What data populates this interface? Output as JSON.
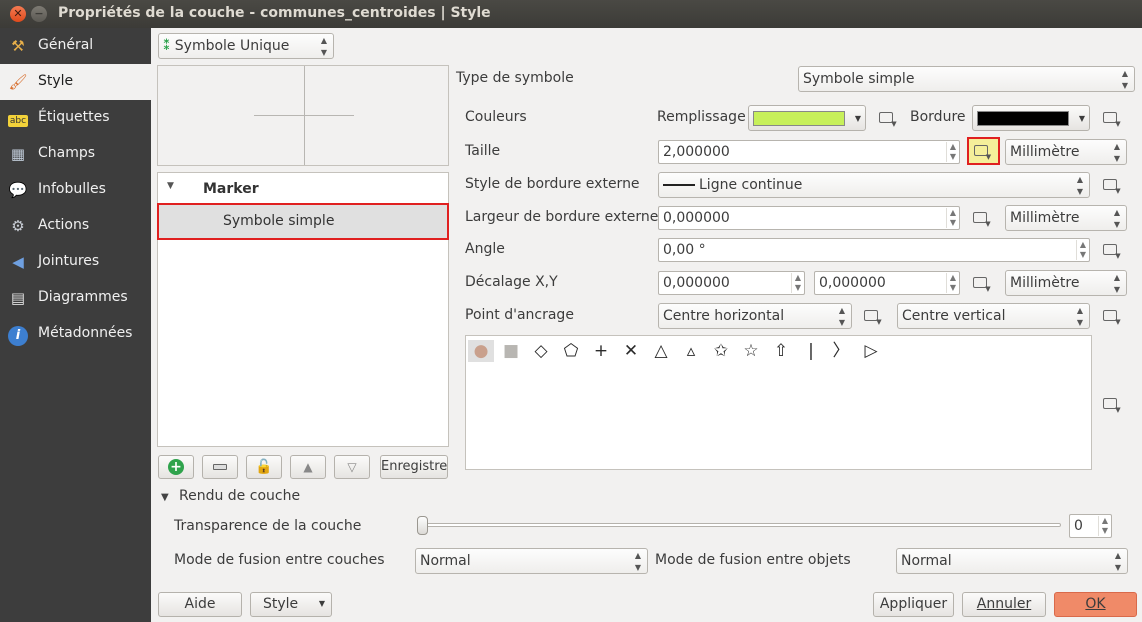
{
  "window": {
    "title": "Propriétés de la couche - communes_centroides | Style",
    "close_icon": "close-icon",
    "minimize_icon": "minimize-icon"
  },
  "sidebar": {
    "items": [
      {
        "label": "Général",
        "icon": "tools-icon"
      },
      {
        "label": "Style",
        "icon": "brush-icon",
        "selected": true
      },
      {
        "label": "Étiquettes",
        "icon": "abc-label-icon"
      },
      {
        "label": "Champs",
        "icon": "table-icon"
      },
      {
        "label": "Infobulles",
        "icon": "speech-bubble-icon"
      },
      {
        "label": "Actions",
        "icon": "gear-icon"
      },
      {
        "label": "Jointures",
        "icon": "join-icon"
      },
      {
        "label": "Diagrammes",
        "icon": "chart-icon"
      },
      {
        "label": "Métadonnées",
        "icon": "info-icon"
      }
    ]
  },
  "renderer": {
    "value": "Symbole Unique"
  },
  "tree": {
    "root": "Marker",
    "child": "Symbole simple"
  },
  "left_buttons": {
    "save": "Enregistrer"
  },
  "props": {
    "symbol_type_label": "Type de symbole",
    "symbol_type_value": "Symbole simple",
    "colors_label": "Couleurs",
    "fill_label": "Remplissage",
    "fill_color": "#c7f05a",
    "border_label": "Bordure",
    "border_color": "#000000",
    "size_label": "Taille",
    "size_value": "2,000000",
    "size_unit": "Millimètre",
    "outline_style_label": "Style de bordure externe",
    "outline_style_value": "Ligne continue",
    "outline_width_label": "Largeur de bordure externe",
    "outline_width_value": "0,000000",
    "outline_width_unit": "Millimètre",
    "angle_label": "Angle",
    "angle_value": "0,00 °",
    "offset_label": "Décalage X,Y",
    "offset_x": "0,000000",
    "offset_y": "0,000000",
    "offset_unit": "Millimètre",
    "anchor_label": "Point d'ancrage",
    "anchor_h": "Centre horizontal",
    "anchor_v": "Centre vertical",
    "shapes": [
      {
        "name": "circle",
        "glyph": "●"
      },
      {
        "name": "square",
        "glyph": "■"
      },
      {
        "name": "diamond",
        "glyph": "◇"
      },
      {
        "name": "pentagon",
        "glyph": "⬠"
      },
      {
        "name": "cross",
        "glyph": "+"
      },
      {
        "name": "x",
        "glyph": "✕"
      },
      {
        "name": "triangle",
        "glyph": "△"
      },
      {
        "name": "equilateral-triangle",
        "glyph": "▵"
      },
      {
        "name": "star",
        "glyph": "✩"
      },
      {
        "name": "regular-star",
        "glyph": "☆"
      },
      {
        "name": "arrow",
        "glyph": "⇧"
      },
      {
        "name": "line",
        "glyph": "|"
      },
      {
        "name": "arrowhead",
        "glyph": "〉"
      },
      {
        "name": "filled-arrowhead",
        "glyph": "▷"
      }
    ]
  },
  "layer_render": {
    "header": "Rendu de couche",
    "transparency_label": "Transparence de la couche",
    "transparency_value": "0",
    "blend_layers_label": "Mode de fusion entre couches",
    "blend_layers_value": "Normal",
    "blend_features_label": "Mode de fusion entre objets",
    "blend_features_value": "Normal"
  },
  "footer": {
    "help": "Aide",
    "style": "Style",
    "apply": "Appliquer",
    "cancel": "Annuler",
    "ok": "OK"
  },
  "colors": {
    "highlight": "#e02020",
    "ok_button": "#f08a68",
    "selected_bg": "#e0e0e0"
  }
}
